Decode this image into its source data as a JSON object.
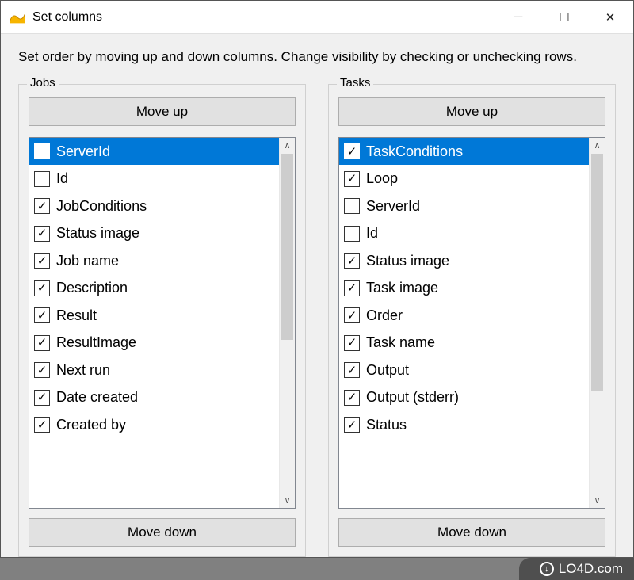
{
  "window": {
    "title": "Set columns",
    "instructions": "Set order by moving up and down columns. Change visibility by checking or unchecking rows."
  },
  "buttons": {
    "move_up": "Move up",
    "move_down": "Move down"
  },
  "jobs": {
    "legend": "Jobs",
    "items": [
      {
        "label": "ServerId",
        "checked": false,
        "selected": true
      },
      {
        "label": "Id",
        "checked": false,
        "selected": false
      },
      {
        "label": "JobConditions",
        "checked": true,
        "selected": false
      },
      {
        "label": "Status image",
        "checked": true,
        "selected": false
      },
      {
        "label": "Job name",
        "checked": true,
        "selected": false
      },
      {
        "label": "Description",
        "checked": true,
        "selected": false
      },
      {
        "label": "Result",
        "checked": true,
        "selected": false
      },
      {
        "label": "ResultImage",
        "checked": true,
        "selected": false
      },
      {
        "label": "Next run",
        "checked": true,
        "selected": false
      },
      {
        "label": "Date created",
        "checked": true,
        "selected": false
      },
      {
        "label": "Created by",
        "checked": true,
        "selected": false
      }
    ]
  },
  "tasks": {
    "legend": "Tasks",
    "items": [
      {
        "label": "TaskConditions",
        "checked": true,
        "selected": true
      },
      {
        "label": "Loop",
        "checked": true,
        "selected": false
      },
      {
        "label": "ServerId",
        "checked": false,
        "selected": false
      },
      {
        "label": "Id",
        "checked": false,
        "selected": false
      },
      {
        "label": "Status image",
        "checked": true,
        "selected": false
      },
      {
        "label": "Task image",
        "checked": true,
        "selected": false
      },
      {
        "label": "Order",
        "checked": true,
        "selected": false
      },
      {
        "label": "Task name",
        "checked": true,
        "selected": false
      },
      {
        "label": "Output",
        "checked": true,
        "selected": false
      },
      {
        "label": "Output (stderr)",
        "checked": true,
        "selected": false
      },
      {
        "label": "Status",
        "checked": true,
        "selected": false
      }
    ]
  },
  "watermark": "LO4D.com"
}
